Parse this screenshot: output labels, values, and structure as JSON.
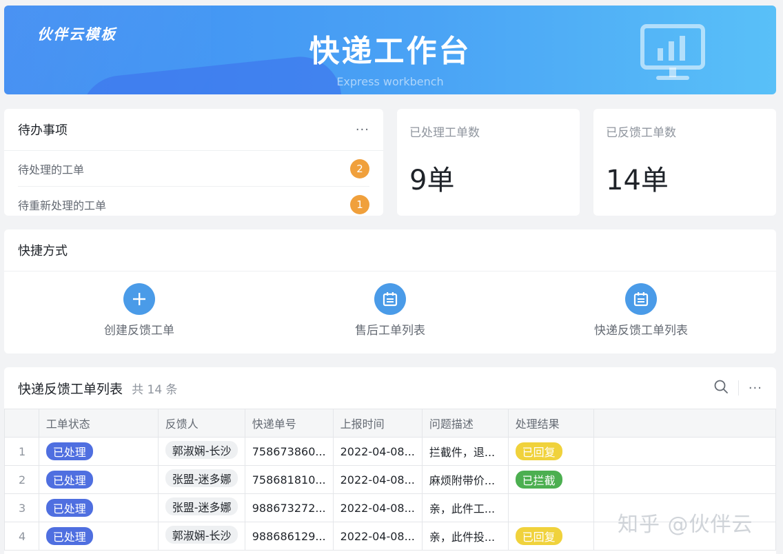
{
  "banner": {
    "brand": "伙伴云模板",
    "title": "快递工作台",
    "subtitle": "Express workbench"
  },
  "todo": {
    "title": "待办事项",
    "more": "···",
    "items": [
      {
        "label": "待处理的工单",
        "count": "2"
      },
      {
        "label": "待重新处理的工单",
        "count": "1"
      }
    ]
  },
  "stats": [
    {
      "label": "已处理工单数",
      "value": "9单"
    },
    {
      "label": "已反馈工单数",
      "value": "14单"
    }
  ],
  "shortcuts": {
    "title": "快捷方式",
    "items": [
      {
        "label": "创建反馈工单",
        "icon": "plus-icon"
      },
      {
        "label": "售后工单列表",
        "icon": "calendar-icon"
      },
      {
        "label": "快递反馈工单列表",
        "icon": "calendar-icon"
      }
    ]
  },
  "table": {
    "title": "快递反馈工单列表",
    "count_label": "共 14 条",
    "more": "···",
    "columns": [
      "",
      "工单状态",
      "反馈人",
      "快递单号",
      "上报时间",
      "问题描述",
      "处理结果",
      ""
    ],
    "rows": [
      {
        "idx": "1",
        "status": "已处理",
        "person": "郭淑娴-长沙",
        "tracking": "758673860...",
        "time": "2022-04-08...",
        "desc": "拦截件，退...",
        "result": "已回复"
      },
      {
        "idx": "2",
        "status": "已处理",
        "person": "张盟-迷多娜",
        "tracking": "758681810...",
        "time": "2022-04-08...",
        "desc": "麻烦附带价...",
        "result": "已拦截"
      },
      {
        "idx": "3",
        "status": "已处理",
        "person": "张盟-迷多娜",
        "tracking": "988673272...",
        "time": "2022-04-08...",
        "desc": "亲，此件工...",
        "result": ""
      },
      {
        "idx": "4",
        "status": "已处理",
        "person": "郭淑娴-长沙",
        "tracking": "988686129...",
        "time": "2022-04-08...",
        "desc": "亲，此件投...",
        "result": "已回复"
      }
    ]
  },
  "colors": {
    "status_tag": "#4f6fe0",
    "result_replied": "#f0d23c",
    "result_intercepted": "#4caf50",
    "badge": "#f0a03c"
  },
  "watermark": "知乎 @伙伴云"
}
